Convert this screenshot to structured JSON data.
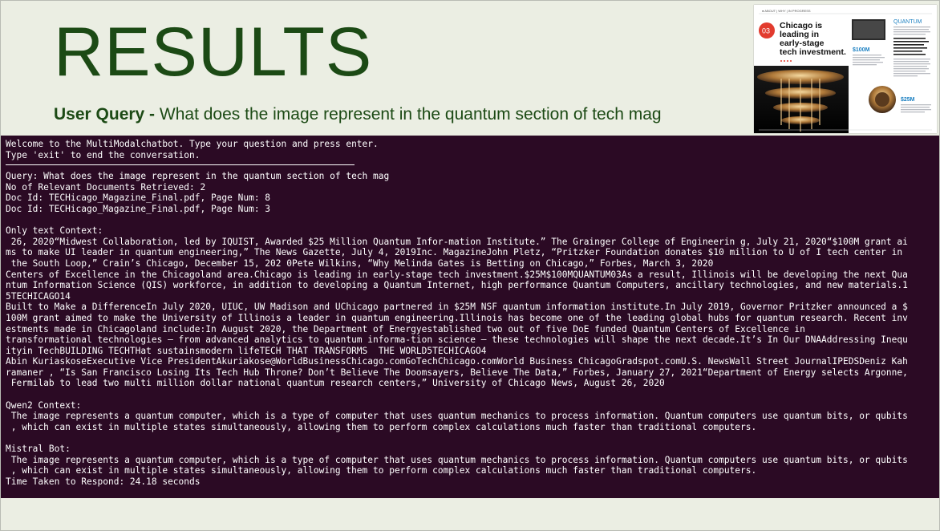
{
  "slide": {
    "title": "RESULTS",
    "query_label": "User Query -",
    "query_text": " What does the image represent in the quantum section of tech mag"
  },
  "magazine": {
    "header": "● ABOUT | WHY | IN PROGRESS",
    "badge": "03",
    "headline": [
      "Chicago is",
      "leading in",
      "early-stage",
      "tech investment."
    ],
    "section": "QUANTUM",
    "stat1": "$100M",
    "stat2": "$25M"
  },
  "terminal": {
    "intro1": "Welcome to the MultiModalchatbot. Type your question and press enter.",
    "intro2": "Type 'exit' to end the conversation.",
    "query": "Query: What does the image represent in the quantum section of tech mag",
    "docs_count": "No of Relevant Documents Retrieved: 2",
    "doc1": "Doc Id: TECHicago_Magazine_Final.pdf, Page Num: 8",
    "doc2": "Doc Id: TECHicago_Magazine_Final.pdf, Page Num: 3",
    "text_context_label": "Only text Context:",
    "text_context": [
      " 26, 2020“Midwest Collaboration, led by IQUIST, Awarded $25 Million Quantum Infor-mation Institute.” The Grainger College of Engineerin g, July 21, 2020“$100M grant ai",
      "ms to make UI leader in quantum engineering,” The News Gazette, July 4, 2019Inc. MagazineJohn Pletz, “Pritzker Foundation donates $10 million to U of I tech center in",
      " the South Loop,” Crain’s Chicago, December 15, 202 0Pete Wilkins, “Why Melinda Gates is Betting on Chicago,” Forbes, March 3, 2020",
      "Centers of Excellence in the Chicagoland area.Chicago is leading in early-stage tech investment.$25M$100MQUANTUM03As a result, Illinois will be developing the next Qua",
      "ntum Information Science (QIS) workforce, in addition to developing a Quantum Internet, high performance Quantum Computers, ancillary technologies, and new materials.1",
      "5TECHICAGO14",
      "Built to Make a DifferenceIn July 2020, UIUC, UW Madison and UChicago partnered in $25M NSF quantum information institute.In July 2019, Governor Pritzker announced a $",
      "100M grant aimed to make the University of Illinois a leader in quantum engineering.Illinois has become one of the leading global hubs for quantum research. Recent inv",
      "estments made in Chicagoland include:In August 2020, the Department of Energyestablished two out of five DoE funded Quantum Centers of Excellence in",
      "transformational technologies – from advanced analytics to quantum informa-tion science – these technologies will shape the next decade.It’s In Our DNAAddressing Inequ",
      "ityin TechBUILDING TECHTHat sustainsmodern lifeTECH THAT TRANSFORMS  THE WORLD5TECHICAGO4",
      "Abin KuriaskoseExecutive Vice PresidentAkuriakose@WorldBusinessChicago.comGoTechChicago.comWorld Business ChicagoGradspot.comU.S. NewsWall Street JournalIPEDSDeniz Kah",
      "ramaner , “Is San Francisco Losing Its Tech Hub Throne? Don’t Believe The Doomsayers, Believe The Data,” Forbes, January 27, 2021“Department of Energy selects Argonne,",
      " Fermilab to lead two multi million dollar national quantum research centers,” University of Chicago News, August 26, 2020"
    ],
    "qwen_label": "Qwen2 Context:",
    "qwen_text": [
      " The image represents a quantum computer, which is a type of computer that uses quantum mechanics to process information. Quantum computers use quantum bits, or qubits",
      " , which can exist in multiple states simultaneously, allowing them to perform complex calculations much faster than traditional computers."
    ],
    "mistral_label": "Mistral Bot:",
    "mistral_text": [
      " The image represents a quantum computer, which is a type of computer that uses quantum mechanics to process information. Quantum computers use quantum bits, or qubits",
      " , which can exist in multiple states simultaneously, allowing them to perform complex calculations much faster than traditional computers."
    ],
    "time_taken": "Time Taken to Respond: 24.18 seconds"
  },
  "colors": {
    "title_green": "#1c4a15",
    "background": "#ebeee3",
    "terminal_bg": "#2b0a24",
    "badge_red": "#e23b2e",
    "accent_blue": "#1a7fc1"
  }
}
